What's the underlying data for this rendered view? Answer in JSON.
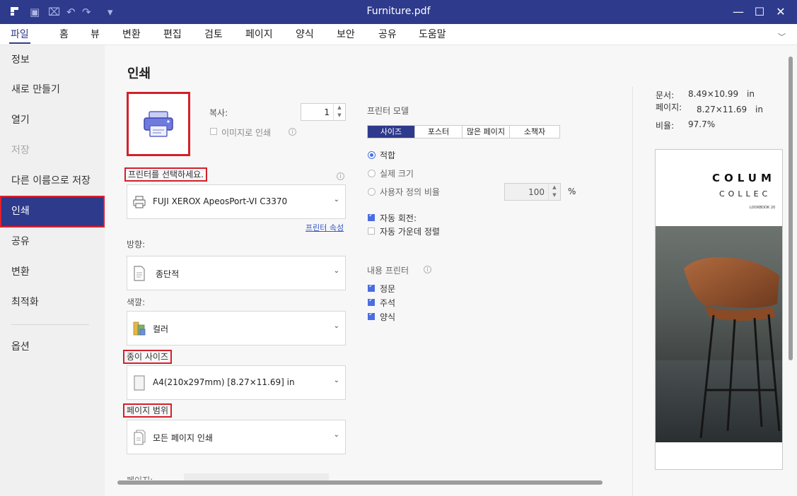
{
  "window": {
    "title": "Furniture.pdf"
  },
  "menu": [
    {
      "label": "파일",
      "active": true
    },
    {
      "label": "홈"
    },
    {
      "label": "뷰"
    },
    {
      "label": "변환"
    },
    {
      "label": "편집"
    },
    {
      "label": "검토"
    },
    {
      "label": "페이지"
    },
    {
      "label": "양식"
    },
    {
      "label": "보안"
    },
    {
      "label": "공유"
    },
    {
      "label": "도움말"
    }
  ],
  "sidebar": {
    "items": [
      {
        "label": "정보"
      },
      {
        "label": "새로 만들기"
      },
      {
        "label": "열기"
      },
      {
        "label": "저장",
        "disabled": true
      },
      {
        "label": "다른 이름으로 저장"
      },
      {
        "label": "인쇄",
        "active": true
      },
      {
        "label": "공유"
      },
      {
        "label": "변환"
      },
      {
        "label": "최적화"
      },
      {
        "label": "옵션"
      }
    ]
  },
  "print": {
    "heading": "인쇄",
    "copies_label": "복사:",
    "copies_value": "1",
    "as_image_label": "이미지로 인쇄",
    "select_printer_label": "프린터를 선택하세요.",
    "printer_name": "FUJI XEROX ApeosPort-VI C3370",
    "printer_props_link": "프린터 속성",
    "orientation_label": "방향:",
    "orientation_value": "종단적",
    "color_label": "색깔:",
    "color_value": "컬러",
    "paper_size_label": "종이 사이즈",
    "paper_size_value": "A4(210x297mm) [8.27×11.69] in",
    "page_range_label": "페이지 범위",
    "page_range_value": "모든 페이지 인쇄",
    "pages_label_partial": "페이지:",
    "printer_model_label": "프린터 모델",
    "modes": [
      {
        "label": "사이즈",
        "active": true
      },
      {
        "label": "포스터"
      },
      {
        "label": "많은 페이지"
      },
      {
        "label": "소책자"
      }
    ],
    "fit_label": "적합",
    "actual_size_label": "실제 크기",
    "custom_scale_label": "사용자 정의 비율",
    "custom_scale_value": "100",
    "percent": "%",
    "auto_rotate_label": "자동 회전:",
    "auto_center_label": "자동 가운데 정렬",
    "content_printer_label": "내용 프린터",
    "content_items": [
      {
        "label": "정문"
      },
      {
        "label": "주석"
      },
      {
        "label": "양식"
      }
    ]
  },
  "doc_info": {
    "document_label": "문서:",
    "document_value": "8.49×10.99",
    "document_unit": "in",
    "page_label": "페이지:",
    "page_value": "8.27×11.69",
    "page_unit": "in",
    "ratio_label": "비율:",
    "ratio_value": "97.7%"
  },
  "preview": {
    "title": "COLUM",
    "subtitle": "COLLEC",
    "tag": "LOOKBOOK 20"
  },
  "colors": {
    "brand": "#2e3a8c",
    "highlight": "#d4202a",
    "accent": "#4a6ee0"
  }
}
